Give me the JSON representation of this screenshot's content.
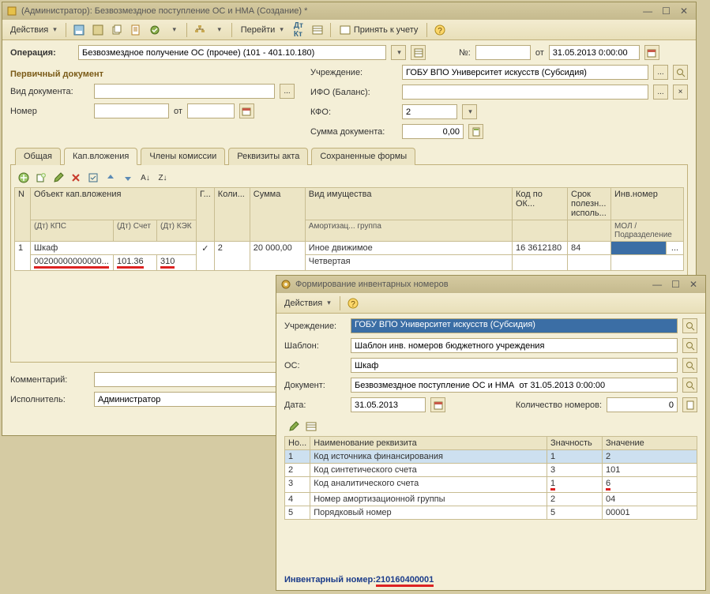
{
  "main": {
    "title": "(Администратор): Безвозмездное поступление ОС и НМА (Создание) *",
    "toolbar": {
      "actions": "Действия",
      "goto": "Перейти",
      "accept": "Принять к учету"
    },
    "op_label": "Операция:",
    "op_value": "Безвозмездное получение ОС (прочее) (101 - 401.10.180)",
    "num_label": "№:",
    "num_value": "",
    "ot_label": "от",
    "date_value": "31.05.2013 0:00:00",
    "primary_doc": "Первичный документ",
    "doctype_label": "Вид документа:",
    "number_label": "Номер",
    "ot2": "от",
    "uchr_label": "Учреждение:",
    "uchr_value": "ГОБУ ВПО Университет искусств (Субсидия)",
    "ifo_label": "ИФО (Баланс):",
    "kfo_label": "КФО:",
    "kfo_value": "2",
    "summ_label": "Сумма документа:",
    "summ_value": "0,00",
    "tabs": {
      "t1": "Общая",
      "t2": "Кап.вложения",
      "t3": "Члены комиссии",
      "t4": "Реквизиты акта",
      "t5": "Сохраненные формы"
    },
    "grid": {
      "h_n": "N",
      "h_obj": "Объект кап.вложения",
      "h_dtkps": "(Дт) КПС",
      "h_dtschet": "(Дт) Счет",
      "h_dtkek": "(Дт) КЭК",
      "h_g": "Г...",
      "h_kol": "Коли...",
      "h_sum": "Сумма",
      "h_vid": "Вид имущества",
      "h_amort": "Амортизац... группа",
      "h_kod": "Код по ОК...",
      "h_srok": "Срок полезн... исполь...",
      "h_inv": "Инв.номер",
      "h_mol": "МОЛ / Подразделение",
      "r1_n": "1",
      "r1_obj": "Шкаф",
      "r1_kps": "00200000000000...",
      "r1_schet": "101.36",
      "r1_kek": "310",
      "r1_check": "✓",
      "r1_kol": "2",
      "r1_sum": "20 000,00",
      "r1_vid1": "Иное движимое",
      "r1_vid2": "Четвертая",
      "r1_kod": "16 3612180",
      "r1_srok": "84",
      "r1_inv": "...",
      "r1_mol": ""
    },
    "comment_label": "Комментарий:",
    "ispol_label": "Исполнитель:",
    "ispol_value": "Администратор"
  },
  "sub": {
    "title": "Формирование инвентарных номеров",
    "toolbar": {
      "actions": "Действия"
    },
    "uchr_label": "Учреждение:",
    "uchr_value": "ГОБУ ВПО Университет искусств (Субсидия)",
    "shabl_label": "Шаблон:",
    "shabl_value": "Шаблон инв. номеров бюджетного учреждения",
    "os_label": "ОС:",
    "os_value": "Шкаф",
    "doc_label": "Документ:",
    "doc_value": "Безвозмездное поступление ОС и НМА  от 31.05.2013 0:00:00",
    "date_label": "Дата:",
    "date_value": "31.05.2013",
    "count_label": "Количество номеров:",
    "count_value": "0",
    "grid": {
      "h_n": "Но...",
      "h_name": "Наименование реквизита",
      "h_zn": "Значность",
      "h_val": "Значение",
      "rows": [
        {
          "n": "1",
          "name": "Код источника финансирования",
          "zn": "1",
          "val": "2"
        },
        {
          "n": "2",
          "name": "Код синтетического счета",
          "zn": "3",
          "val": "101"
        },
        {
          "n": "3",
          "name": "Код аналитического счета",
          "zn": "1",
          "val": "6"
        },
        {
          "n": "4",
          "name": "Номер амортизационной группы",
          "zn": "2",
          "val": "04"
        },
        {
          "n": "5",
          "name": "Порядковый номер",
          "zn": "5",
          "val": "00001"
        }
      ]
    },
    "footer_label": "Инвентарный номер:",
    "footer_value": "210160400001"
  }
}
